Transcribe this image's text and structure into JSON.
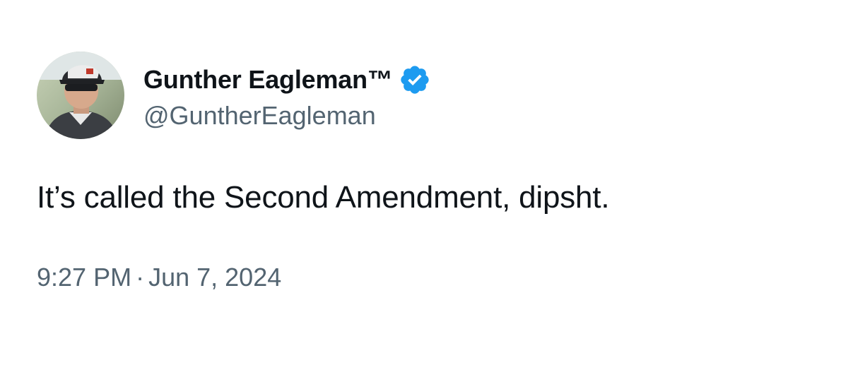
{
  "tweet": {
    "author": {
      "display_name": "Gunther Eagleman™",
      "handle": "@GuntherEagleman",
      "verified_icon": "verified-badge-icon",
      "avatar": "profile-photo"
    },
    "text": "It’s called the Second Amendment, dipsht.",
    "time": "9:27 PM",
    "separator": "·",
    "date": "Jun 7, 2024"
  },
  "colors": {
    "primary_text": "#0f1419",
    "secondary_text": "#536471",
    "verified_blue": "#1d9bf0",
    "background": "#ffffff"
  }
}
